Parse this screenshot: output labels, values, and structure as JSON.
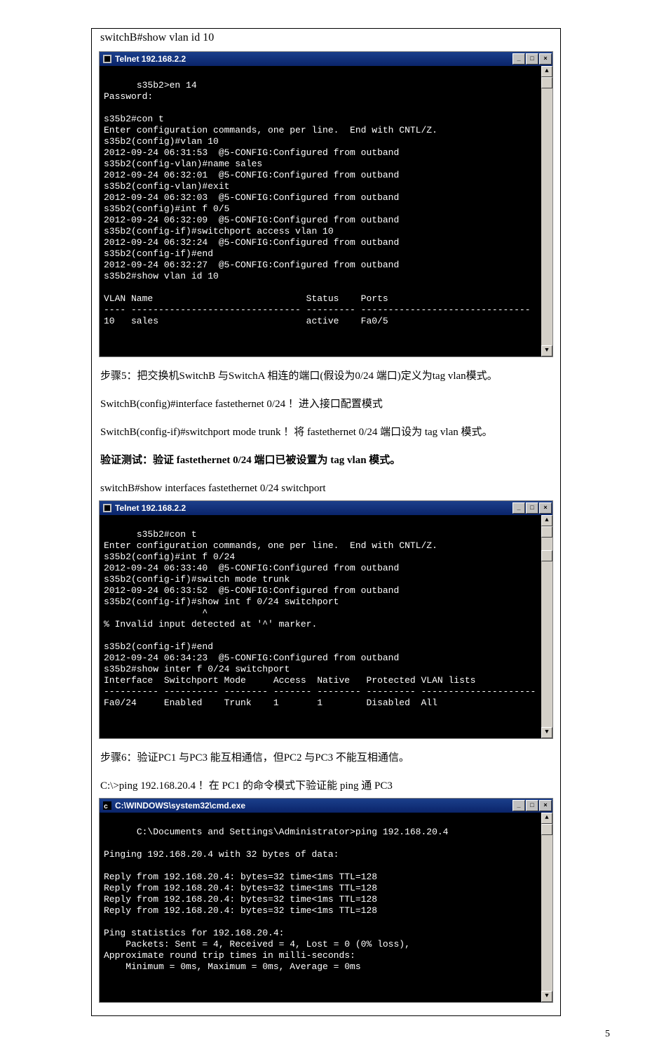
{
  "intro_cmd": "switchB#show vlan id 10",
  "term1_title": "Telnet 192.168.2.2",
  "term1_body": "s35b2>en 14\nPassword:\n\ns35b2#con t\nEnter configuration commands, one per line.  End with CNTL/Z.\ns35b2(config)#vlan 10\n2012-09-24 06:31:53  @5-CONFIG:Configured from outband\ns35b2(config-vlan)#name sales\n2012-09-24 06:32:01  @5-CONFIG:Configured from outband\ns35b2(config-vlan)#exit\n2012-09-24 06:32:03  @5-CONFIG:Configured from outband\ns35b2(config)#int f 0/5\n2012-09-24 06:32:09  @5-CONFIG:Configured from outband\ns35b2(config-if)#switchport access vlan 10\n2012-09-24 06:32:24  @5-CONFIG:Configured from outband\ns35b2(config-if)#end\n2012-09-24 06:32:27  @5-CONFIG:Configured from outband\ns35b2#show vlan id 10\n\nVLAN Name                            Status    Ports\n---- ------------------------------- --------- -------------------------------\n10   sales                           active    Fa0/5",
  "step5_heading": "步骤5：把交换机SwitchB 与SwitchA 相连的端口(假设为0/24 端口)定义为tag vlan模式。",
  "step5_line1": "SwitchB(config)#interface fastethernet 0/24  ！进入接口配置模式",
  "step5_line2": "SwitchB(config-if)#switchport mode trunk  ！将 fastethernet 0/24  端口设为 tag vlan  模式。",
  "step5_bold": "验证测试：验证 fastethernet 0/24 端口已被设置为 tag vlan 模式。",
  "step5_cmd": "switchB#show interfaces fastethernet 0/24 switchport",
  "term2_title": "Telnet 192.168.2.2",
  "term2_body": "s35b2#con t\nEnter configuration commands, one per line.  End with CNTL/Z.\ns35b2(config)#int f 0/24\n2012-09-24 06:33:40  @5-CONFIG:Configured from outband\ns35b2(config-if)#switch mode trunk\n2012-09-24 06:33:52  @5-CONFIG:Configured from outband\ns35b2(config-if)#show int f 0/24 switchport\n                  ^\n% Invalid input detected at '^' marker.\n\ns35b2(config-if)#end\n2012-09-24 06:34:23  @5-CONFIG:Configured from outband\ns35b2#show inter f 0/24 switchport\nInterface  Switchport Mode     Access  Native   Protected VLAN lists\n---------- ---------- -------- ------- -------- --------- ---------------------\nFa0/24     Enabled    Trunk    1       1        Disabled  All",
  "step6_heading": "步骤6：验证PC1 与PC3 能互相通信，但PC2 与PC3 不能互相通信。",
  "step6_line1": "C:\\>ping 192.168.20.4  ！在 PC1 的命令模式下验证能 ping  通 PC3",
  "term3_title": "C:\\WINDOWS\\system32\\cmd.exe",
  "term3_body": "C:\\Documents and Settings\\Administrator>ping 192.168.20.4\n\nPinging 192.168.20.4 with 32 bytes of data:\n\nReply from 192.168.20.4: bytes=32 time<1ms TTL=128\nReply from 192.168.20.4: bytes=32 time<1ms TTL=128\nReply from 192.168.20.4: bytes=32 time<1ms TTL=128\nReply from 192.168.20.4: bytes=32 time<1ms TTL=128\n\nPing statistics for 192.168.20.4:\n    Packets: Sent = 4, Received = 4, Lost = 0 (0% loss),\nApproximate round trip times in milli-seconds:\n    Minimum = 0ms, Maximum = 0ms, Average = 0ms",
  "win_min": "_",
  "win_max": "□",
  "win_close": "×",
  "arrow_up": "▲",
  "arrow_down": "▼",
  "page_number": "5"
}
